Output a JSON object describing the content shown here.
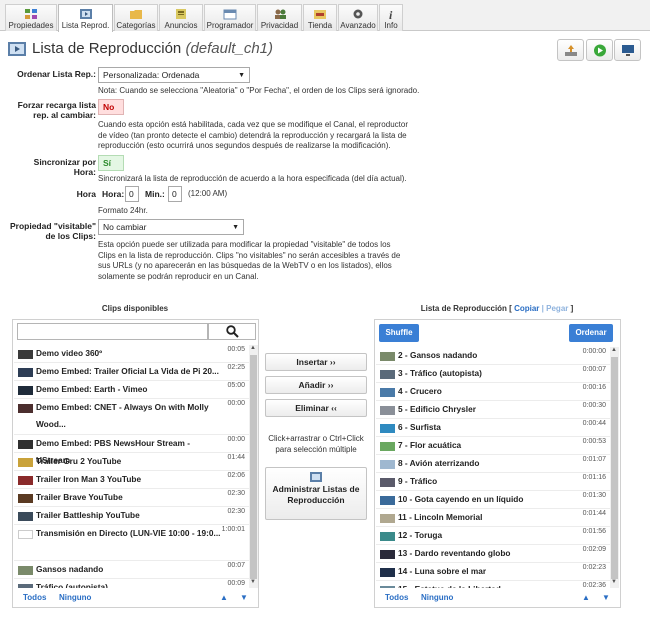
{
  "tabs": [
    {
      "label": "Propiedades",
      "icon": "properties-icon"
    },
    {
      "label": "Lista Reprod.",
      "icon": "playlist-icon"
    },
    {
      "label": "Categorías",
      "icon": "folder-icon"
    },
    {
      "label": "Anuncios",
      "icon": "ads-icon"
    },
    {
      "label": "Programador",
      "icon": "calendar-icon"
    },
    {
      "label": "Privacidad",
      "icon": "users-icon"
    },
    {
      "label": "Tienda",
      "icon": "store-icon"
    },
    {
      "label": "Avanzado",
      "icon": "gear-icon"
    },
    {
      "label": "Info",
      "icon": "info-icon"
    }
  ],
  "header": {
    "title": "Lista de Reproducción",
    "subtitle": "default_ch1"
  },
  "form": {
    "order_label": "Ordenar Lista Rep.:",
    "order_value": "Personalizada: Ordenada",
    "order_note": "Nota: Cuando se selecciona \"Aleatoria\" o \"Por Fecha\", el orden de los Clips será ignorado.",
    "force_label_1": "Forzar recarga lista",
    "force_label_2": "rep. al cambiar:",
    "force_value": "No",
    "force_note": "Cuando esta opción está habilitada, cada vez que se modifique el Canal, el reproductor de vídeo (tan pronto detecte el cambio) detendrá la reproducción y recargará la lista de reproducción (esto ocurrirá unos segundos después de realizarse la modificación).",
    "sync_label": "Sincronizar por Hora:",
    "sync_value": "Sí",
    "sync_note": "Sincronizará la lista de reproducción de acuerdo a la hora especificada (del día actual).",
    "hour_label": "Hora",
    "hora_label": "Hora:",
    "hora_value": "0",
    "min_label": "Min.:",
    "min_value": "0",
    "time_display": "(12:00 AM)",
    "format_note": "Formato 24hr.",
    "visible_label_1": "Propiedad \"visitable\"",
    "visible_label_2": "de los Clips:",
    "visible_value": "No cambiar",
    "visible_note": "Esta opción puede ser utilizada para modificar la propiedad \"visitable\" de todos los Clips en la lista de reproducción. Clips \"no visitables\" no serán accesibles a través de sus URLs (y no aparecerán en las búsquedas de la WebTV o en los listados), ellos solamente se podrán reproducir en un Canal."
  },
  "clips": {
    "title": "Clips disponibles",
    "items": [
      {
        "name": "Demo video 360º",
        "duration": "00:05",
        "color": "#3a3a3a"
      },
      {
        "name": "Demo Embed: Trailer Oficial La Vida de Pi 20...",
        "duration": "02:25",
        "color": "#2d3d55"
      },
      {
        "name": "Demo Embed: Earth - Vimeo",
        "duration": "05:00",
        "color": "#1f2b3a"
      },
      {
        "name": "Demo Embed: CNET - Always On with Molly Wood...",
        "duration": "00:00",
        "color": "#4b2e2e",
        "tall": true
      },
      {
        "name": "Demo Embed: PBS NewsHour Stream - UStream",
        "duration": "00:00",
        "color": "#2f2f2f"
      },
      {
        "name": "Trailer Gru 2 YouTube",
        "duration": "01:44",
        "color": "#c9a23a"
      },
      {
        "name": "Trailer Iron Man 3 YouTube",
        "duration": "02:06",
        "color": "#8a2a2a"
      },
      {
        "name": "Trailer Brave YouTube",
        "duration": "02:30",
        "color": "#5a3a22"
      },
      {
        "name": "Trailer Battleship YouTube",
        "duration": "02:30",
        "color": "#3a4a5a"
      },
      {
        "name": "Transmisión en Directo (LUN-VIE 10:00 - 19:0...",
        "duration": "1:00:01",
        "color": "#ffffff",
        "tall": true
      },
      {
        "name": "Gansos nadando",
        "duration": "00:07",
        "color": "#7a8a6a"
      },
      {
        "name": "Tráfico (autopista)",
        "duration": "00:09",
        "color": "#5a6a7a"
      }
    ],
    "search_placeholder": "",
    "all_label": "Todos",
    "none_label": "Ninguno",
    "up_label": "▲",
    "down_label": "▼"
  },
  "middle": {
    "insert_label": "Insertar ››",
    "add_label": "Añadir ››",
    "remove_label": "Eliminar ‹‹",
    "hint": "Click+arrastrar o Ctrl+Click para selección múltiple",
    "admin_label": "Administrar Listas de Reproducción"
  },
  "playlist": {
    "title": "Lista de Reproducción",
    "copy_label": "Copiar",
    "sep": "|",
    "paste_label": "Pegar",
    "bracket_open": "[",
    "bracket_close": "]",
    "shuffle_label": "Shuffle",
    "order_label": "Ordenar",
    "items": [
      {
        "name": "2 - Gansos nadando",
        "duration": "0:00:00",
        "color": "#7a8a6a"
      },
      {
        "name": "3 - Tráfico (autopista)",
        "duration": "0:00:07",
        "color": "#5a6a7a"
      },
      {
        "name": "4 - Crucero",
        "duration": "0:00:16",
        "color": "#4a7aa8"
      },
      {
        "name": "5 - Edificio Chrysler",
        "duration": "0:00:30",
        "color": "#8a8f98"
      },
      {
        "name": "6 - Surfista",
        "duration": "0:00:44",
        "color": "#2f8ac0"
      },
      {
        "name": "7 - Flor acuática",
        "duration": "0:00:53",
        "color": "#6aa860"
      },
      {
        "name": "8 - Avión aterrizando",
        "duration": "0:01:07",
        "color": "#9fb8d0"
      },
      {
        "name": "9 - Tráfico",
        "duration": "0:01:16",
        "color": "#5a5a6a"
      },
      {
        "name": "10 - Gota cayendo en un líquido",
        "duration": "0:01:30",
        "color": "#3a6a9a"
      },
      {
        "name": "11 - Lincoln Memorial",
        "duration": "0:01:44",
        "color": "#b0a890"
      },
      {
        "name": "12 - Toruga",
        "duration": "0:01:56",
        "color": "#3a8a8a"
      },
      {
        "name": "13 - Dardo reventando globo",
        "duration": "0:02:09",
        "color": "#2a2a3a"
      },
      {
        "name": "14 - Luna sobre el mar",
        "duration": "0:02:23",
        "color": "#1f2f4a"
      },
      {
        "name": "15 - Estatua de la Libertad",
        "duration": "0:02:36",
        "color": "#6a8a9a"
      }
    ],
    "all_label": "Todos",
    "none_label": "Ninguno",
    "up_label": "▲",
    "down_label": "▼"
  },
  "colors": {
    "accent": "#3a7fd5",
    "link": "#2a6ec4",
    "no_bg": "#ffdede",
    "si_bg": "#e4f7e4"
  }
}
